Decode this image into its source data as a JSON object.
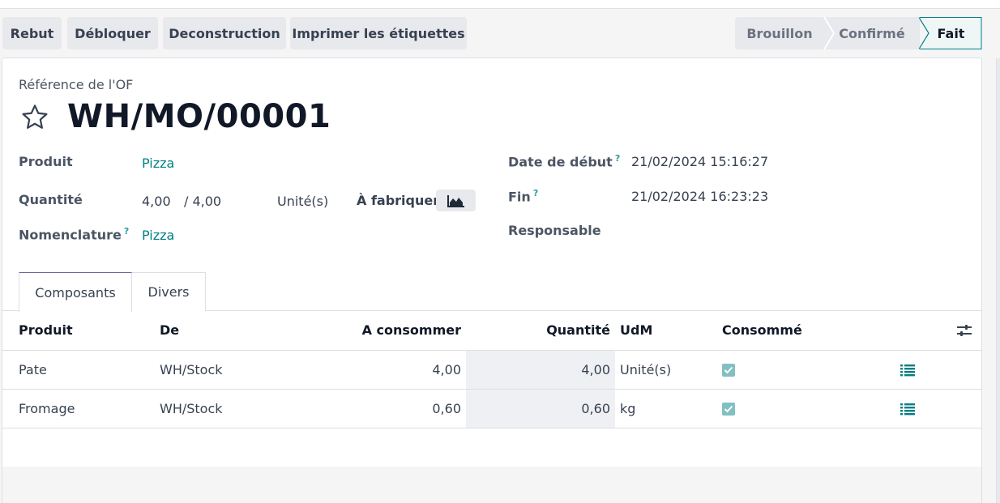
{
  "toolbar": {
    "rebut": "Rebut",
    "debloquer": "Débloquer",
    "deconstruction": "Deconstruction",
    "imprimer": "Imprimer les étiquettes"
  },
  "status": {
    "stages": [
      "Brouillon",
      "Confirmé",
      "Fait"
    ],
    "current": "Fait"
  },
  "record": {
    "ref_label": "Référence de l'OF",
    "name": "WH/MO/00001"
  },
  "fields": {
    "produit_label": "Produit",
    "produit_value": "Pizza",
    "quantite_label": "Quantité",
    "quantite_value": "4,00",
    "quantite_target": "/ 4,00",
    "uom": "Unité(s)",
    "a_fabriquer": "À fabriquer",
    "nomenclature_label": "Nomenclature",
    "nomenclature_value": "Pizza",
    "date_debut_label": "Date de début",
    "date_debut_value": "21/02/2024 15:16:27",
    "fin_label": "Fin",
    "fin_value": "21/02/2024 16:23:23",
    "responsable_label": "Responsable",
    "help_mark": "?"
  },
  "tabs": [
    "Composants",
    "Divers"
  ],
  "table": {
    "headers": [
      "Produit",
      "De",
      "A consommer",
      "Quantité",
      "UdM",
      "Consommé"
    ],
    "rows": [
      {
        "produit": "Pate",
        "de": "WH/Stock",
        "a_consommer": "4,00",
        "quantite": "4,00",
        "udm": "Unité(s)",
        "consomme": true
      },
      {
        "produit": "Fromage",
        "de": "WH/Stock",
        "a_consommer": "0,60",
        "quantite": "0,60",
        "udm": "kg",
        "consomme": true
      }
    ]
  },
  "colors": {
    "accent": "#017e84",
    "tab_active_top": "#71639e",
    "checkbox": "#82bfc2"
  },
  "icons": [
    "star-icon",
    "chart-area-icon",
    "list-detail-icon",
    "column-settings-icon",
    "checkbox-checked-icon"
  ]
}
